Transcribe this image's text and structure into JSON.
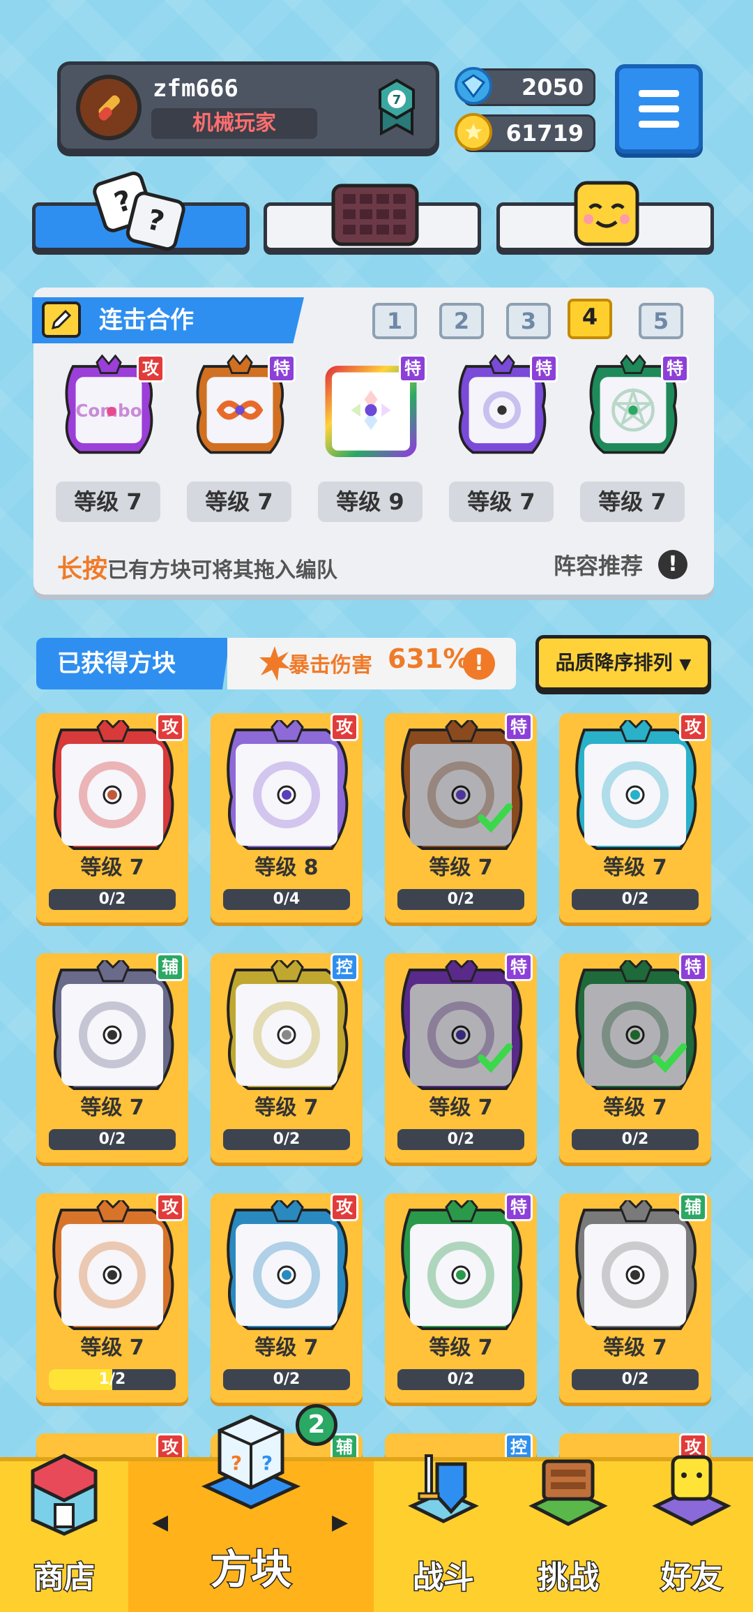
{
  "profile": {
    "username": "zfm666",
    "title": "机械玩家",
    "rank": "7"
  },
  "currency": {
    "gems": "2050",
    "coins": "61719"
  },
  "tabs": [
    "dice",
    "board",
    "emote"
  ],
  "panel": {
    "title": "连击合作",
    "pages": [
      "1",
      "2",
      "3",
      "4",
      "5"
    ],
    "active_page": "4",
    "slots": [
      {
        "badge": "攻",
        "type": "atk",
        "level": "等级 7",
        "color": "#9b3fd8",
        "art": "combo"
      },
      {
        "badge": "特",
        "type": "spe",
        "level": "等级 7",
        "color": "#d07020",
        "art": "infinity"
      },
      {
        "badge": "特",
        "type": "spe",
        "level": "等级 9",
        "color": "#d84040",
        "art": "rainbow"
      },
      {
        "badge": "特",
        "type": "spe",
        "level": "等级 7",
        "color": "#7a4ad8",
        "art": "cycle"
      },
      {
        "badge": "特",
        "type": "spe",
        "level": "等级 7",
        "color": "#1e8a5a",
        "art": "pentagram"
      }
    ],
    "hint_highlight": "长按",
    "hint_text": "已有方块可将其拖入编队",
    "lineup_label": "阵容推荐"
  },
  "owned": {
    "label": "已获得方块",
    "crit_label": "暴击伤害",
    "crit_value": "631%",
    "sort_label": "品质降序排列"
  },
  "cards": [
    {
      "badge": "攻",
      "type": "atk",
      "level": "等级 7",
      "progress": "0/2",
      "fill": 0,
      "color": "#d83a3a",
      "center": "#c0583a",
      "check": false
    },
    {
      "badge": "攻",
      "type": "atk",
      "level": "等级 8",
      "progress": "0/4",
      "fill": 0,
      "color": "#8e6ad8",
      "center": "#5b3fb8",
      "check": false
    },
    {
      "badge": "特",
      "type": "spe",
      "level": "等级 7",
      "progress": "0/2",
      "fill": 0,
      "color": "#8a4a1e",
      "center": "#6b4ad8",
      "check": true
    },
    {
      "badge": "攻",
      "type": "atk",
      "level": "等级 7",
      "progress": "0/2",
      "fill": 0,
      "color": "#2ab0c8",
      "center": "#2ab0c8",
      "check": false
    },
    {
      "badge": "辅",
      "type": "sup",
      "level": "等级 7",
      "progress": "0/2",
      "fill": 0,
      "color": "#6a6a8a",
      "center": "#333",
      "check": false
    },
    {
      "badge": "控",
      "type": "ctl",
      "level": "等级 7",
      "progress": "0/2",
      "fill": 0,
      "color": "#c0a830",
      "center": "#888",
      "check": false
    },
    {
      "badge": "特",
      "type": "spe",
      "level": "等级 7",
      "progress": "0/2",
      "fill": 0,
      "color": "#5a2a8a",
      "center": "#4a3aa8",
      "check": true
    },
    {
      "badge": "特",
      "type": "spe",
      "level": "等级 7",
      "progress": "0/2",
      "fill": 0,
      "color": "#1e6a3a",
      "center": "#2a8a3a",
      "check": true
    },
    {
      "badge": "攻",
      "type": "atk",
      "level": "等级 7",
      "progress": "1/2",
      "fill": 0.5,
      "color": "#d8742a",
      "center": "#333",
      "check": false
    },
    {
      "badge": "攻",
      "type": "atk",
      "level": "等级 7",
      "progress": "0/2",
      "fill": 0,
      "color": "#2a8ac0",
      "center": "#2a8ac0",
      "check": false
    },
    {
      "badge": "特",
      "type": "spe",
      "level": "等级 7",
      "progress": "0/2",
      "fill": 0,
      "color": "#2a9a4a",
      "center": "#2a9a4a",
      "check": false
    },
    {
      "badge": "辅",
      "type": "sup",
      "level": "等级 7",
      "progress": "0/2",
      "fill": 0,
      "color": "#7a7a7a",
      "center": "#333",
      "check": false
    }
  ],
  "partial_badges": [
    {
      "badge": "攻",
      "type": "atk"
    },
    {
      "badge": "辅",
      "type": "sup"
    },
    {
      "badge": "控",
      "type": "ctl"
    },
    {
      "badge": "攻",
      "type": "atk"
    }
  ],
  "nav": {
    "shop": "商店",
    "blocks": "方块",
    "blocks_badge": "2",
    "battle": "战斗",
    "challenge": "挑战",
    "friends": "好友"
  },
  "colors": {
    "accent": "#2f8ff0",
    "card": "#ffc23a",
    "nav": "#ffcf2e"
  }
}
